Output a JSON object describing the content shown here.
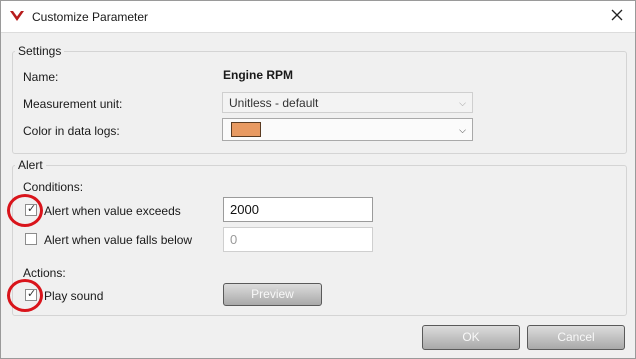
{
  "window": {
    "title": "Customize Parameter",
    "logo_icon": "chevron-v-logo",
    "logo_color": "#b71c1c",
    "close_icon": "close-icon"
  },
  "settings": {
    "legend": "Settings",
    "name_label": "Name:",
    "name_value": "Engine RPM",
    "unit_label": "Measurement unit:",
    "unit_value": "Unitless - default",
    "color_label": "Color in data logs:",
    "color_value": "#e89a62"
  },
  "alert": {
    "legend": "Alert",
    "conditions_label": "Conditions:",
    "exceeds_label": "Alert when value exceeds",
    "exceeds_checked": true,
    "exceeds_value": "2000",
    "falls_label": "Alert when value falls below",
    "falls_checked": false,
    "falls_value": "0",
    "actions_label": "Actions:",
    "sound_label": "Play sound",
    "sound_checked": true,
    "preview_label": "Preview"
  },
  "footer": {
    "ok_label": "OK",
    "cancel_label": "Cancel"
  },
  "annotation_color": "#d9141b"
}
